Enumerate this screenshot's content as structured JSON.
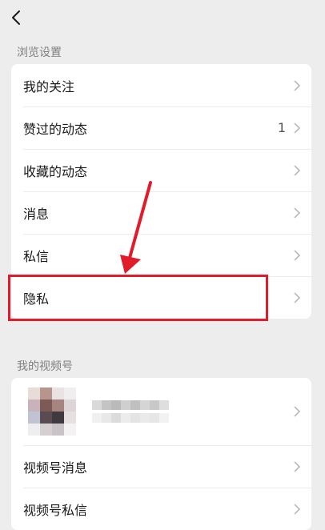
{
  "header": {
    "back_icon": "chevron-left-icon"
  },
  "browsing": {
    "title": "浏览设置",
    "items": [
      {
        "label": "我的关注",
        "count": ""
      },
      {
        "label": "赞过的动态",
        "count": "1"
      },
      {
        "label": "收藏的动态",
        "count": ""
      },
      {
        "label": "消息",
        "count": ""
      },
      {
        "label": "私信",
        "count": ""
      },
      {
        "label": "隐私",
        "count": ""
      }
    ]
  },
  "channels": {
    "title": "我的视频号",
    "items": [
      {
        "label": "视频号消息"
      },
      {
        "label": "视频号私信"
      }
    ]
  },
  "colors": {
    "background": "#ededed",
    "card": "#ffffff",
    "annotation": "#e11b2a"
  }
}
